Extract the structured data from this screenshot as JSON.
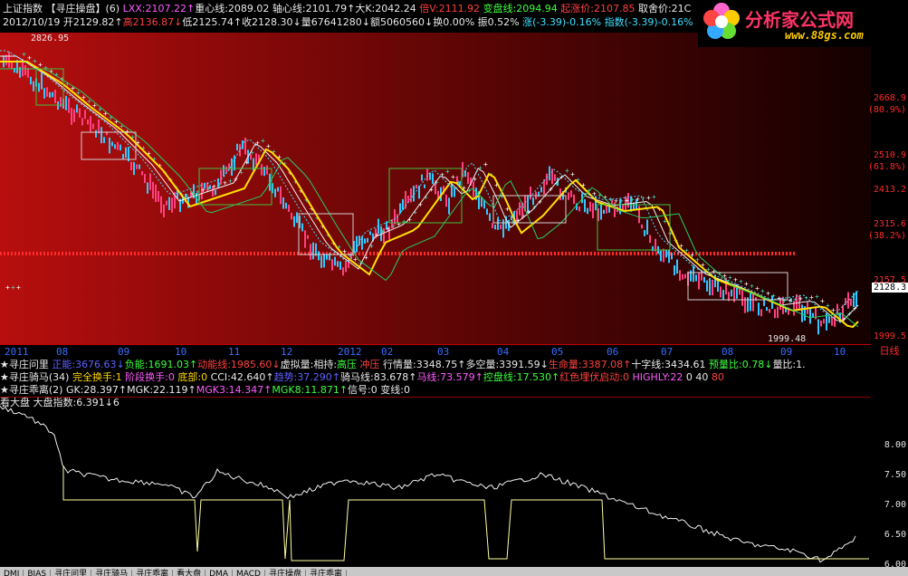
{
  "header": {
    "line1": [
      {
        "t": "上证指数",
        "c": "w"
      },
      {
        "t": " 【寻庄操盘】(6) ",
        "c": "w"
      },
      {
        "t": "LXX:2107.22↑",
        "c": "m"
      },
      {
        "t": "重心线:2089.02",
        "c": "w"
      },
      {
        "t": " 轴心线:2101.79↑",
        "c": "w"
      },
      {
        "t": "大K:2042.24 ",
        "c": "w"
      },
      {
        "t": "倍V:2111.92 ",
        "c": "r"
      },
      {
        "t": "变盘线:2094.94 ",
        "c": "g"
      },
      {
        "t": "起涨价:2107.85 ",
        "c": "r"
      },
      {
        "t": "取舍价:21C",
        "c": "w"
      }
    ],
    "line2": [
      {
        "t": "2012/10/19 开2129.82↑",
        "c": "w"
      },
      {
        "t": "高2136.87↓",
        "c": "r"
      },
      {
        "t": "低2125.74↑",
        "c": "w"
      },
      {
        "t": "收2128.30↓",
        "c": "w"
      },
      {
        "t": "量67641280↓",
        "c": "w"
      },
      {
        "t": "额5060560↓",
        "c": "w"
      },
      {
        "t": "换0.00% ",
        "c": "w"
      },
      {
        "t": "振0.52% ",
        "c": "w"
      },
      {
        "t": "涨(-3.39)-0.16% ",
        "c": "c"
      },
      {
        "t": "指数(-3.39)-0.16%",
        "c": "c"
      }
    ]
  },
  "logo": {
    "text": "分析家公式网",
    "url": "www.88gs.com"
  },
  "main_chart": {
    "price_labels": {
      "high": "2826.95",
      "low": "1999.48",
      "last": "2128.3"
    },
    "y_ticks": [
      {
        "v": "2668.9",
        "p": "(80.9%)",
        "y": 67
      },
      {
        "v": "2510.9",
        "p": "(61.8%)",
        "y": 130
      },
      {
        "v": "2413.2",
        "p": "",
        "y": 168
      },
      {
        "v": "2315.6",
        "p": "(38.2%)",
        "y": 206
      },
      {
        "v": "2157.5",
        "p": "",
        "y": 268
      },
      {
        "v": "1999.5",
        "p": "",
        "y": 330
      }
    ],
    "x_labels": [
      {
        "t": "2011",
        "x": 5
      },
      {
        "t": "08",
        "x": 62
      },
      {
        "t": "09",
        "x": 130
      },
      {
        "t": "10",
        "x": 193
      },
      {
        "t": "11",
        "x": 252
      },
      {
        "t": "12",
        "x": 310
      },
      {
        "t": "2012",
        "x": 373
      },
      {
        "t": "02",
        "x": 421
      },
      {
        "t": "03",
        "x": 483
      },
      {
        "t": "04",
        "x": 549
      },
      {
        "t": "05",
        "x": 609
      },
      {
        "t": "06",
        "x": 670
      },
      {
        "t": "07",
        "x": 730
      },
      {
        "t": "08",
        "x": 797
      },
      {
        "t": "09",
        "x": 862
      },
      {
        "t": "10",
        "x": 921
      }
    ],
    "period": "日线"
  },
  "indicators": {
    "row1": [
      {
        "t": "★寻庄问里 ",
        "c": "w"
      },
      {
        "t": "正能:3676.63↓",
        "c": "b"
      },
      {
        "t": "负能:1691.03↑",
        "c": "g"
      },
      {
        "t": "动能线:1985.60↓",
        "c": "r"
      },
      {
        "t": "虚拟量:相持:",
        "c": "w"
      },
      {
        "t": "高压 ",
        "c": "g"
      },
      {
        "t": "冲压 ",
        "c": "r"
      },
      {
        "t": "行情量:3348.75↑",
        "c": "w"
      },
      {
        "t": "多空量:3391.59↓",
        "c": "w"
      },
      {
        "t": "生命量:3387.08↑",
        "c": "r"
      },
      {
        "t": "十字线:3434.61 ",
        "c": "w"
      },
      {
        "t": "预量比:0.78↓",
        "c": "g"
      },
      {
        "t": "量比:1.",
        "c": "w"
      }
    ],
    "row2": [
      {
        "t": "★寻庄骑马(34) ",
        "c": "w"
      },
      {
        "t": "完全换手:1 ",
        "c": "y"
      },
      {
        "t": "阶段换手:0 ",
        "c": "m"
      },
      {
        "t": "底部:0 ",
        "c": "y"
      },
      {
        "t": "CCI:42.640↑",
        "c": "w"
      },
      {
        "t": "趋势:37.290↑",
        "c": "b"
      },
      {
        "t": "骑马线:83.678↑",
        "c": "w"
      },
      {
        "t": "马线:73.579↑",
        "c": "m"
      },
      {
        "t": "控盘线:17.530↑",
        "c": "g"
      },
      {
        "t": "红色埋伏启动:0 ",
        "c": "r"
      },
      {
        "t": "HIGHLY:22 ",
        "c": "m"
      },
      {
        "t": "0 ",
        "c": "w"
      },
      {
        "t": "40 ",
        "c": "w"
      },
      {
        "t": "80",
        "c": "r"
      }
    ],
    "row3": [
      {
        "t": "★寻庄乖离(2) ",
        "c": "w"
      },
      {
        "t": "GK:28.397↑",
        "c": "w"
      },
      {
        "t": "MGK:22.119↑",
        "c": "w"
      },
      {
        "t": "MGK3:14.347↑",
        "c": "m"
      },
      {
        "t": "MGK8:11.871↑",
        "c": "g"
      },
      {
        "t": "信号:0 ",
        "c": "w"
      },
      {
        "t": "变线:0",
        "c": "w"
      }
    ],
    "row4": [
      {
        "t": "看大盘 ",
        "c": "w"
      },
      {
        "t": "大盘指数:6.391↓6",
        "c": "w"
      }
    ]
  },
  "sub_chart": {
    "y_ticks": [
      {
        "v": "8.00",
        "y": 48
      },
      {
        "v": "7.50",
        "y": 81
      },
      {
        "v": "7.00",
        "y": 114
      },
      {
        "v": "6.50",
        "y": 147
      },
      {
        "v": "6.00",
        "y": 180
      }
    ]
  },
  "tabs": [
    "DMI",
    "BIAS",
    "寻庄问里",
    "寻庄骑马",
    "寻庄乖离",
    "看大盘",
    "DMA",
    "MACD",
    "寻庄操盘",
    "寻庄乖离"
  ]
}
